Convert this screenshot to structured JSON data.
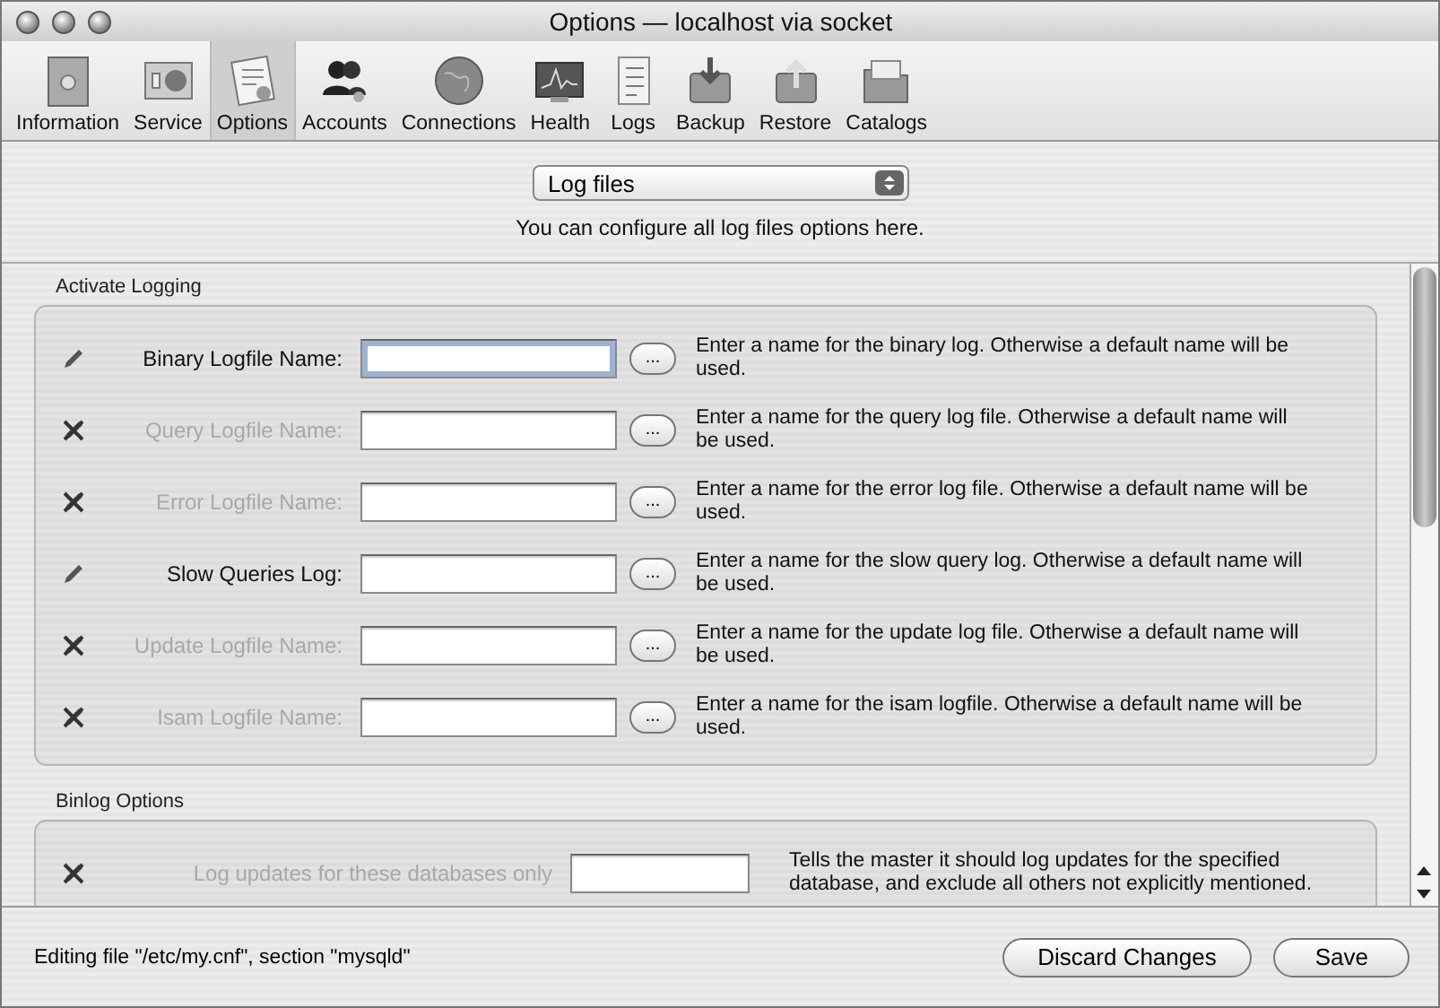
{
  "window": {
    "title": "Options — localhost via socket"
  },
  "toolbar": [
    {
      "label": "Information",
      "selected": false
    },
    {
      "label": "Service",
      "selected": false
    },
    {
      "label": "Options",
      "selected": true
    },
    {
      "label": "Accounts",
      "selected": false
    },
    {
      "label": "Connections",
      "selected": false
    },
    {
      "label": "Health",
      "selected": false
    },
    {
      "label": "Logs",
      "selected": false
    },
    {
      "label": "Backup",
      "selected": false
    },
    {
      "label": "Restore",
      "selected": false
    },
    {
      "label": "Catalogs",
      "selected": false
    }
  ],
  "section_select": {
    "value": "Log files",
    "hint": "You can configure all log files options here."
  },
  "groups": [
    {
      "title": "Activate Logging",
      "rows": [
        {
          "label": "Binary Logfile Name:",
          "enabled": true,
          "focused": true,
          "description": "Enter a name for the binary log. Otherwise a default name will be used."
        },
        {
          "label": "Query Logfile Name:",
          "enabled": false,
          "focused": false,
          "description": "Enter a name for the query log file. Otherwise a default name will be used."
        },
        {
          "label": "Error Logfile Name:",
          "enabled": false,
          "focused": false,
          "description": "Enter a name for the error log file. Otherwise a default name will be used."
        },
        {
          "label": "Slow Queries Log:",
          "enabled": true,
          "focused": false,
          "description": "Enter a name for the slow query log. Otherwise a default name will be used."
        },
        {
          "label": "Update Logfile Name:",
          "enabled": false,
          "focused": false,
          "description": "Enter a name for the update log file. Otherwise a default name will be used."
        },
        {
          "label": "Isam Logfile Name:",
          "enabled": false,
          "focused": false,
          "description": "Enter a name for the isam logfile. Otherwise a default name will be used."
        }
      ]
    },
    {
      "title": "Binlog Options",
      "rows": [
        {
          "label": "Log updates for these databases only",
          "enabled": false,
          "focused": false,
          "description": "Tells the master it should log updates for the specified database, and exclude all others not explicitly mentioned."
        }
      ]
    }
  ],
  "browse_button": "...",
  "status": "Editing file \"/etc/my.cnf\", section \"mysqld\"",
  "buttons": [
    "Discard Changes",
    "Save"
  ]
}
